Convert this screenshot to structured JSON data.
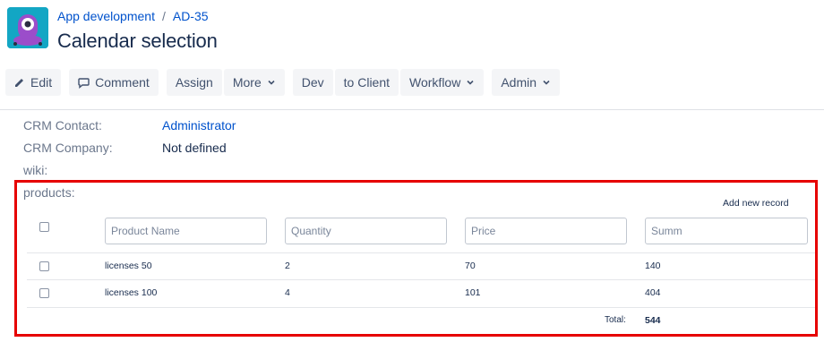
{
  "header": {
    "breadcrumb": [
      "App development",
      "/",
      "AD-35"
    ],
    "title": "Calendar selection"
  },
  "toolbar": {
    "edit": "Edit",
    "comment": "Comment",
    "assign": "Assign",
    "more": "More",
    "dev": "Dev",
    "to_client": "to Client",
    "workflow": "Workflow",
    "admin": "Admin"
  },
  "fields": {
    "crm_contact_label": "CRM Contact:",
    "crm_contact_value": "Administrator",
    "crm_company_label": "CRM Company:",
    "crm_company_value": "Not defined",
    "wiki_label": "wiki:",
    "products_label": "products:"
  },
  "products": {
    "add_new_record": "Add new record",
    "columns": {
      "name": "Product Name",
      "quantity": "Quantity",
      "price": "Price",
      "summ": "Summ"
    },
    "rows": [
      {
        "name": "licenses 50",
        "quantity": "2",
        "price": "70",
        "summ": "140"
      },
      {
        "name": "licenses 100",
        "quantity": "4",
        "price": "101",
        "summ": "404"
      }
    ],
    "total_label": "Total:",
    "total_value": "544"
  },
  "colors": {
    "link": "#0052cc",
    "highlight": "#e60000",
    "avatar": "#13a6c4"
  }
}
